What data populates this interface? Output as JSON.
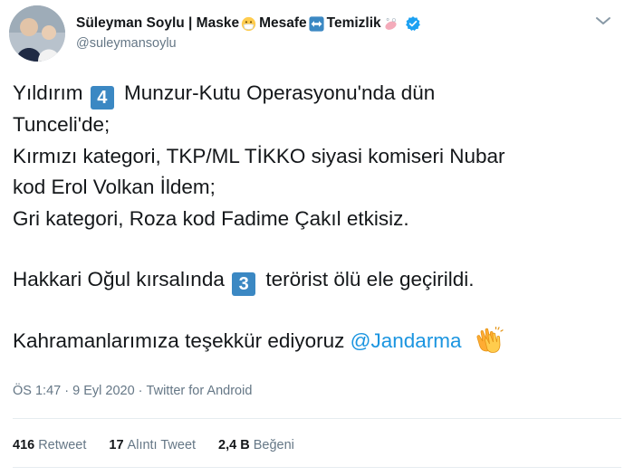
{
  "user": {
    "name": "Süleyman Soylu | Maske",
    "name_mesafe": "Mesafe",
    "name_temizlik": "Temizlik",
    "handle": "@suleymansoylu",
    "emoji_icons": [
      "face-with-medical-mask-icon",
      "left-right-arrow-icon",
      "soap-icon"
    ]
  },
  "tweet": {
    "line1_a": "Yıldırım",
    "line1_num": "4",
    "line1_b": "Munzur-Kutu Operasyonu'nda dün",
    "line2": "Tunceli'de;",
    "line3": "Kırmızı kategori, TKP/ML TİKKO siyasi komiseri Nubar",
    "line4": "kod Erol Volkan İldem;",
    "line5": "Gri kategori, Roza kod Fadime Çakıl etkisiz.",
    "line6_a": "Hakkari Oğul kırsalında",
    "line6_num": "3",
    "line6_b": "terörist ölü ele geçirildi.",
    "line7_a": "Kahramanlarımıza teşekkür ediyoruz",
    "mention": "@Jandarma",
    "end_icon": "clapping-hands-icon"
  },
  "meta": {
    "time": "ÖS 1:47",
    "sep1": "·",
    "date": "9 Eyl 2020",
    "sep2": "·",
    "source": "Twitter for Android"
  },
  "stats": {
    "retweet_count": "416",
    "retweet_label": "Retweet",
    "quote_count": "17",
    "quote_label": "Alıntı Tweet",
    "like_count": "2,4 B",
    "like_label": "Beğeni"
  },
  "colors": {
    "accent": "#1b95e0",
    "muted": "#657786",
    "keycap": "#3b88c3",
    "divider": "#e6ecf0"
  }
}
